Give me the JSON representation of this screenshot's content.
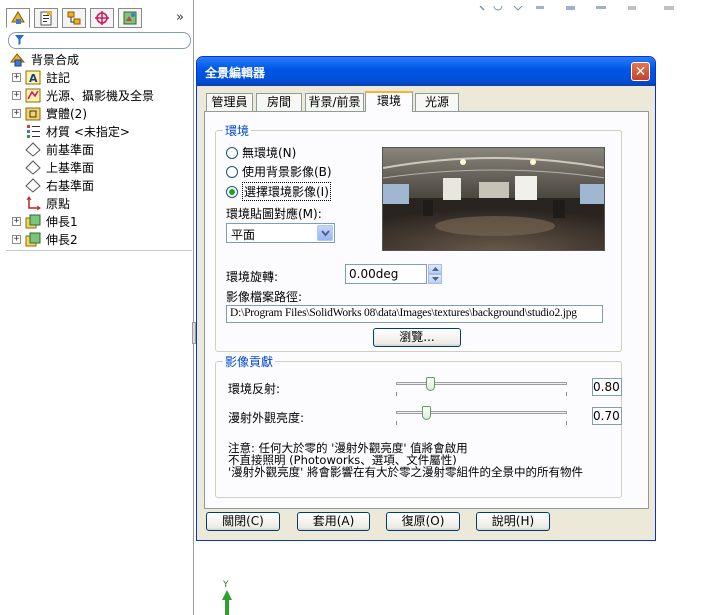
{
  "feature_manager": {
    "tabs": [
      "feature-manager-tab",
      "property-manager-tab",
      "configuration-manager-tab",
      "dimxpert-tab",
      "display-manager-tab"
    ],
    "more": "»",
    "tree": [
      {
        "label": "背景合成",
        "icon": "part-icon",
        "expand": ""
      },
      {
        "label": "註記",
        "icon": "annotations-icon",
        "expand": "+"
      },
      {
        "label": "光源、攝影機及全景",
        "icon": "lights-icon",
        "expand": "+"
      },
      {
        "label": "實體(2)",
        "icon": "solid-bodies-icon",
        "expand": "+"
      },
      {
        "label": "材質 <未指定>",
        "icon": "material-icon",
        "expand": ""
      },
      {
        "label": "前基準面",
        "icon": "plane-icon",
        "expand": ""
      },
      {
        "label": "上基準面",
        "icon": "plane-icon",
        "expand": ""
      },
      {
        "label": "右基準面",
        "icon": "plane-icon",
        "expand": ""
      },
      {
        "label": "原點",
        "icon": "origin-icon",
        "expand": ""
      },
      {
        "label": "伸長1",
        "icon": "extrude-icon",
        "expand": "+"
      },
      {
        "label": "伸長2",
        "icon": "extrude-icon",
        "expand": "+"
      }
    ]
  },
  "triad": {
    "axis": "Y"
  },
  "dialog": {
    "title": "全景編輯器",
    "close": "✕",
    "tabs": [
      {
        "label": "管理員",
        "active": false
      },
      {
        "label": "房間",
        "active": false
      },
      {
        "label": "背景/前景",
        "active": false
      },
      {
        "label": "環境",
        "active": true
      },
      {
        "label": "光源",
        "active": false
      }
    ],
    "environment": {
      "group_label": "環境",
      "options": [
        {
          "label": "無環境(N)",
          "selected": false
        },
        {
          "label": "使用背景影像(B)",
          "selected": false
        },
        {
          "label": "選擇環境影像(I)",
          "selected": true
        }
      ],
      "mapping_label": "環境貼圖對應(M):",
      "mapping_value": "平面",
      "rotation_label": "環境旋轉:",
      "rotation_value": "0.00deg",
      "path_label": "影像檔案路徑:",
      "path_value": "D:\\Program Files\\SolidWorks 08\\data\\Images\\textures\\background\\studio2.jpg",
      "browse": "瀏覽..."
    },
    "contribution": {
      "group_label": "影像貢獻",
      "reflection_label": "環境反射:",
      "reflection_value": "0.80",
      "diffuse_label": "漫射外觀亮度:",
      "diffuse_value": "0.70",
      "note_line1": "注意: 任何大於零的 '漫射外觀亮度' 值將會啟用",
      "note_line2": "不直接照明 (Photoworks、選項、文件屬性)",
      "note_line3": "'漫射外觀亮度' 將會影響在有大於零之漫射零組件的全景中的所有物件"
    },
    "buttons": {
      "close": "關閉(C)",
      "apply": "套用(A)",
      "restore": "復原(O)",
      "help": "說明(H)"
    }
  }
}
